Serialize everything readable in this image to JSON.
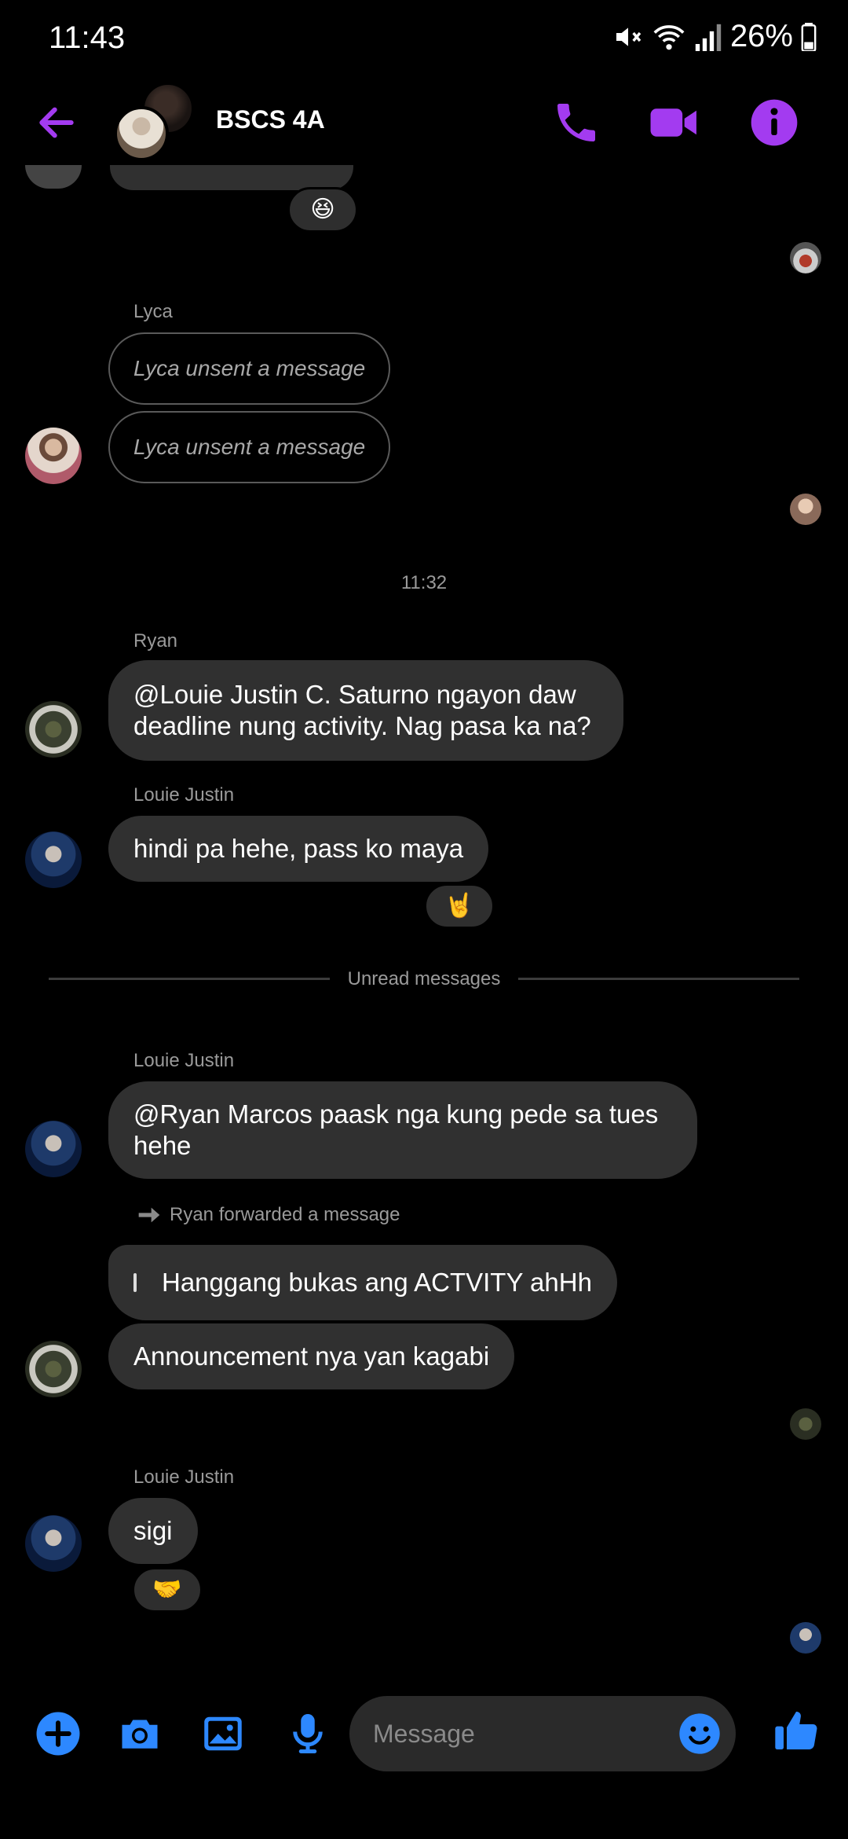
{
  "status_bar": {
    "time": "11:43",
    "battery": "26%"
  },
  "header": {
    "title": "BSCS 4A"
  },
  "colors": {
    "accent_purple": "#A33BF0",
    "accent_blue": "#2D88FF",
    "bubble": "#303030"
  },
  "messages": {
    "lyca_sender": "Lyca",
    "lyca_unsent_1": "Lyca unsent a message",
    "lyca_unsent_2": "Lyca unsent a message",
    "timestamp": "11:32",
    "ryan_sender": "Ryan",
    "ryan_msg_1": "@Louie Justin C. Saturno ngayon daw deadline nung activity. Nag pasa ka na?",
    "louie_sender_1": "Louie Justin",
    "louie_msg_1": "hindi pa hehe, pass ko maya",
    "louie_reaction_1": "🤘",
    "unread_label": "Unread messages",
    "louie_sender_2": "Louie Justin",
    "louie_msg_2": "@Ryan Marcos paask nga kung pede sa tues hehe",
    "forward_note": "Ryan forwarded a message",
    "forwarded_msg": "Hanggang bukas ang ACTVITY ahHh",
    "ryan_msg_2": "Announcement nya yan kagabi",
    "louie_sender_3": "Louie Justin",
    "louie_msg_3": "sigi",
    "louie_reaction_3": "🤝",
    "top_reaction": "😆"
  },
  "composer": {
    "placeholder": "Message"
  },
  "icons": {
    "back": "arrow-left-icon",
    "call": "phone-icon",
    "video": "video-icon",
    "info": "info-icon",
    "plus": "plus-icon",
    "camera": "camera-icon",
    "gallery": "image-icon",
    "mic": "microphone-icon",
    "emoji": "emoji-icon",
    "like": "thumbs-up-icon"
  }
}
